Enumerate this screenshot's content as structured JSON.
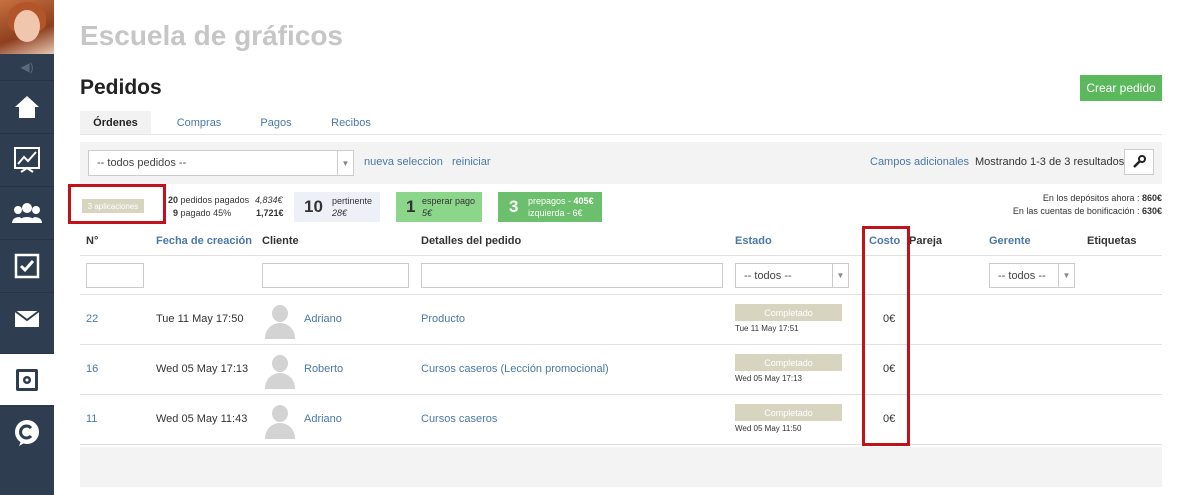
{
  "app": {
    "school_title": "Escuela de gráficos",
    "page_title": "Pedidos",
    "create_button": "Crear pedido"
  },
  "tabs": [
    {
      "label": "Órdenes",
      "active": true
    },
    {
      "label": "Compras",
      "active": false
    },
    {
      "label": "Pagos",
      "active": false
    },
    {
      "label": "Recibos",
      "active": false
    }
  ],
  "filter": {
    "orders_select": "-- todos pedidos --",
    "new_selection": "nueva seleccion",
    "reset": "reiniciar",
    "extra_fields": "Campos adicionales",
    "showing": "Mostrando 1-3 de 3 resultados."
  },
  "stats": {
    "applications": "3 aplicaciones",
    "paid_count": "20",
    "paid_label": "pedidos pagados",
    "paid_amount": "4,834€",
    "paid_pct_count": "9",
    "paid_pct_label": "pagado 45%",
    "paid_pct_amount": "1,721€",
    "relevant_count": "10",
    "relevant_label": "pertinente",
    "relevant_amount": "28€",
    "waiting_count": "1",
    "waiting_label": "esperar pago",
    "waiting_amount": "5€",
    "prepaid_count": "3",
    "prepaid_label": "prepagos -",
    "prepaid_amount": "405€",
    "left_label": "izquierda -",
    "left_amount": "6€",
    "deposits_label": "En los depósitos ahora :",
    "deposits_amount": "860€",
    "bonus_label": "En las cuentas de bonificación :",
    "bonus_amount": "630€"
  },
  "columns": {
    "number": "N°",
    "created": "Fecha de creación",
    "client": "Cliente",
    "details": "Detalles del pedido",
    "status": "Estado",
    "cost": "Costo",
    "partner": "Pareja",
    "manager": "Gerente",
    "tags": "Etiquetas"
  },
  "column_filters": {
    "status_select": "-- todos --",
    "manager_select": "-- todos --"
  },
  "rows": [
    {
      "id": "22",
      "created": "Tue 11 May 17:50",
      "client": "Adriano",
      "details": "Producto",
      "status": "Completado",
      "status_date": "Tue 11 May 17:51",
      "cost": "0€"
    },
    {
      "id": "16",
      "created": "Wed 05 May 17:13",
      "client": "Roberto",
      "details": "Cursos caseros (Lección promocional)",
      "status": "Completado",
      "status_date": "Wed 05 May 17:13",
      "cost": "0€"
    },
    {
      "id": "11",
      "created": "Wed 05 May 11:43",
      "client": "Adriano",
      "details": "Cursos caseros",
      "status": "Completado",
      "status_date": "Wed 05 May 11:50",
      "cost": "0€"
    }
  ],
  "colors": {
    "sidebar": "#2e3d4f",
    "link": "#4a78a8",
    "create_button": "#5cb85c",
    "waiting_box": "#8bd68b",
    "prepaid_box": "#6cbf6c",
    "highlight_frame": "#c0121a"
  }
}
